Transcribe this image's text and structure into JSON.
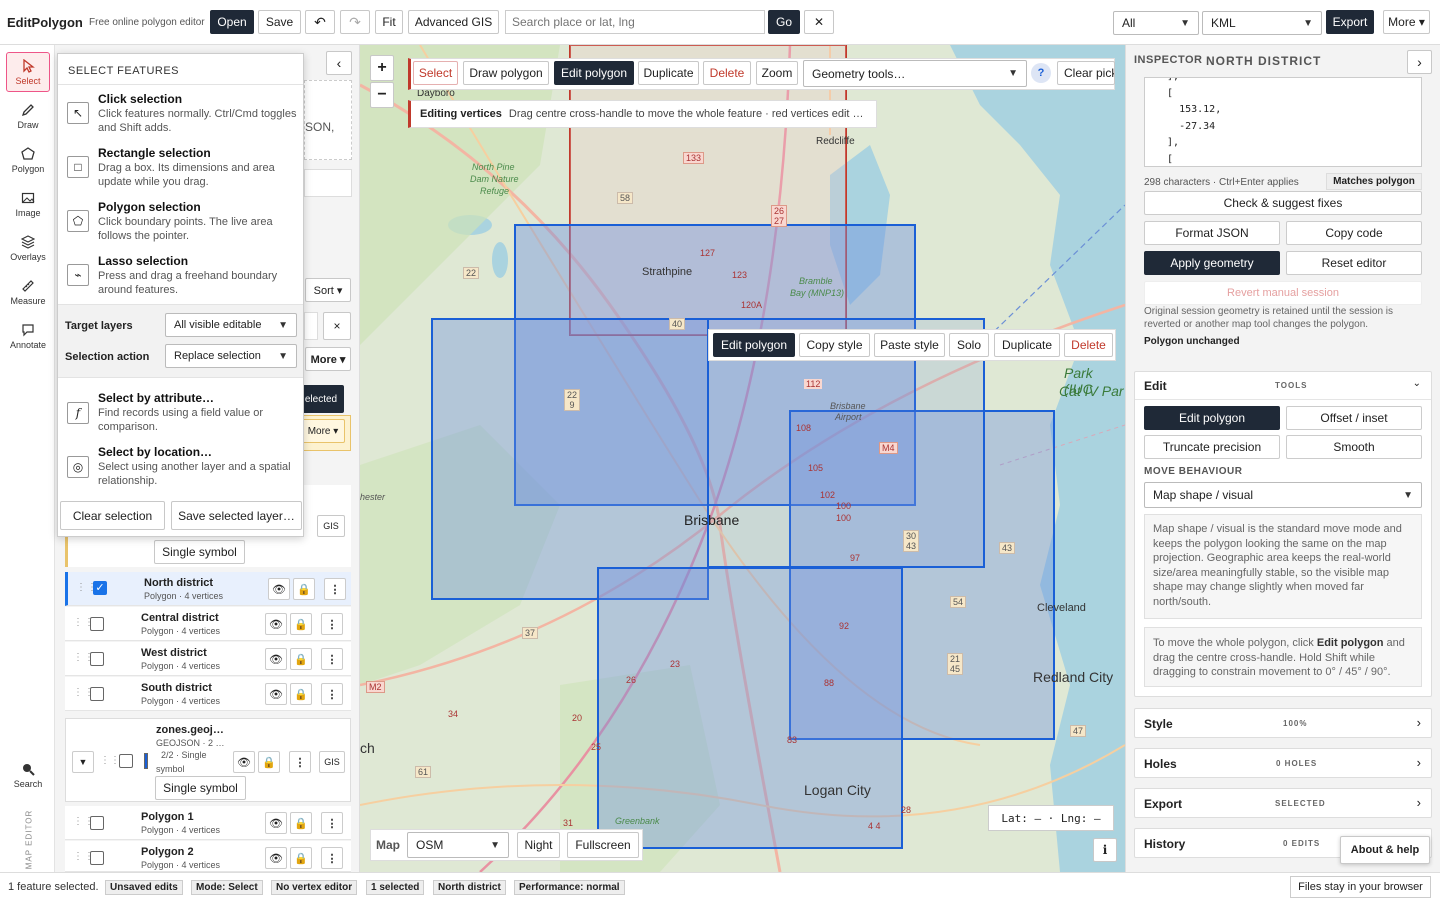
{
  "top": {
    "app": "EditPolygon",
    "tagline": "Free online polygon editor",
    "open": "Open",
    "save": "Save",
    "undo": "↶",
    "redo": "↷",
    "fit": "Fit",
    "advanced": "Advanced GIS",
    "search_placeholder": "Search place or lat, lng",
    "go": "Go",
    "clear": "✕",
    "scope": "All",
    "format": "KML",
    "export": "Export",
    "more": "More ▾"
  },
  "rail": [
    {
      "label": "Select",
      "icon": "cursor-icon"
    },
    {
      "label": "Draw",
      "icon": "pencil-icon"
    },
    {
      "label": "Polygon",
      "icon": "polygon-icon"
    },
    {
      "label": "Image",
      "icon": "image-icon"
    },
    {
      "label": "Overlays",
      "icon": "layers-icon"
    },
    {
      "label": "Measure",
      "icon": "ruler-icon"
    },
    {
      "label": "Annotate",
      "icon": "comment-icon"
    },
    {
      "label": "Search",
      "icon": "search-icon"
    }
  ],
  "rail_vertical": "MAP EDITOR",
  "select_dd": {
    "heading": "SELECT FEATURES",
    "items": [
      {
        "title": "Click selection",
        "desc": "Click features normally. Ctrl/Cmd toggles and Shift adds.",
        "icon": "↖"
      },
      {
        "title": "Rectangle selection",
        "desc": "Drag a box. Its dimensions and area update while you drag.",
        "icon": "□"
      },
      {
        "title": "Polygon selection",
        "desc": "Click boundary points. The live area follows the pointer.",
        "icon": "⬠"
      },
      {
        "title": "Lasso selection",
        "desc": "Press and drag a freehand boundary around features.",
        "icon": "⌁"
      }
    ],
    "target_label": "Target layers",
    "target_value": "All visible editable",
    "action_label": "Selection action",
    "action_value": "Replace selection",
    "attr_title": "Select by attribute…",
    "attr_desc": "Find records using a field value or comparison.",
    "loc_title": "Select by location…",
    "loc_desc": "Select using another layer and a spatial relationship.",
    "clear": "Clear selection",
    "save": "Save selected layer…"
  },
  "left": {
    "collapse": "‹",
    "frag_json": "SON,",
    "sort": "Sort ▾",
    "x": "×",
    "more": "More ▾",
    "selected": "elected",
    "more2": "More ▾",
    "gis": "GIS",
    "single_symbol": "Single symbol"
  },
  "layers": [
    {
      "name": "North district",
      "sub": "Polygon · 4 vertices",
      "checked": true
    },
    {
      "name": "Central district",
      "sub": "Polygon · 4 vertices",
      "checked": false
    },
    {
      "name": "West district",
      "sub": "Polygon · 4 vertices",
      "checked": false
    },
    {
      "name": "South district",
      "sub": "Polygon · 4 vertices",
      "checked": false
    }
  ],
  "group2": {
    "name": "zones.geoj…",
    "sub": "GEOJSON · 2 …",
    "sub2": "2/2 · Single",
    "sub3": "symbol",
    "gis": "GIS",
    "single": "Single symbol"
  },
  "layers2": [
    {
      "name": "Polygon 1",
      "sub": "Polygon · 4 vertices"
    },
    {
      "name": "Polygon 2",
      "sub": "Polygon · 4 vertices"
    }
  ],
  "map": {
    "zoom_in": "+",
    "zoom_out": "−",
    "tools": [
      "Select",
      "Draw polygon",
      "Edit polygon",
      "Duplicate",
      "Delete",
      "Zoom"
    ],
    "geom": "Geometry tools…",
    "help": "?",
    "clear_pick": "Clear pick",
    "banner_title": "Editing vertices",
    "banner_text": "Drag centre cross-handle to move the whole feature · red vertices edit …",
    "ctx": [
      "Edit polygon",
      "Copy style",
      "Paste style",
      "Solo",
      "Duplicate",
      "Delete"
    ],
    "basemap_label": "Map",
    "basemap": "OSM",
    "night": "Night",
    "fullscreen": "Fullscreen",
    "latlng": "Lat: – · Lng: –",
    "info": "i",
    "places": [
      {
        "t": "Dayboro"
      },
      {
        "t": "Redcliffe"
      },
      {
        "t": "North Pine"
      },
      {
        "t": "Dam Nature"
      },
      {
        "t": "Refuge"
      },
      {
        "t": "Strathpine"
      },
      {
        "t": "Bramble"
      },
      {
        "t": "Bay (MNP13)"
      },
      {
        "t": "Park (IUC"
      },
      {
        "t": "Cat IV Par"
      },
      {
        "t": "Brisbane"
      },
      {
        "t": "Airport"
      },
      {
        "t": "Brisbane"
      },
      {
        "t": "Cleveland"
      },
      {
        "t": "Redland City"
      },
      {
        "t": "Logan City"
      },
      {
        "t": "hester"
      },
      {
        "t": "ch"
      },
      {
        "t": "Greenbank"
      }
    ],
    "shields": [
      "133",
      "58",
      "26 27",
      "22",
      "40",
      "112",
      "108",
      "105",
      "102",
      "100",
      "100",
      "97",
      "30 43",
      "43",
      "54",
      "21 45",
      "47",
      "92",
      "88",
      "83",
      "37",
      "M2",
      "M4",
      "61",
      "34",
      "26",
      "23",
      "20",
      "4 4",
      "28",
      "31",
      "25",
      "22 9",
      "123",
      "120A",
      "127"
    ]
  },
  "inspector": {
    "label": "INSPECTOR",
    "title": "NORTH DISTRICT",
    "code": [
      "  ],",
      "  [",
      "    153.12,",
      "    -27.34",
      "  ],",
      "  ["
    ],
    "chars": "298 characters · Ctrl+Enter applies",
    "matches": "Matches polygon",
    "check": "Check & suggest fixes",
    "format": "Format JSON",
    "copy": "Copy code",
    "apply": "Apply geometry",
    "reset": "Reset editor",
    "revert": "Revert manual session",
    "note": "Original session geometry is retained until the session is reverted or another map tool changes the polygon.",
    "unchanged": "Polygon unchanged",
    "edit_title": "Edit",
    "tools_label": "TOOLS",
    "edit_poly": "Edit polygon",
    "offset": "Offset / inset",
    "truncate": "Truncate precision",
    "smooth": "Smooth",
    "move_label": "MOVE BEHAVIOUR",
    "move_value": "Map shape / visual",
    "move_help": "Map shape / visual is the standard move mode and keeps the polygon looking the same on the map projection. Geographic area keeps the real-world size/area meaningfully stable, so the visible map shape may change slightly when moved far north/south.",
    "move_tip_a": "To move the whole polygon, click ",
    "move_tip_b": "Edit polygon",
    "move_tip_c": " and drag the centre cross-handle. Hold Shift while dragging to constrain movement to 0° / 45° / 90°.",
    "sections": [
      {
        "t": "Style",
        "m": "100%"
      },
      {
        "t": "Holes",
        "m": "0 HOLES"
      },
      {
        "t": "Export",
        "m": "SELECTED"
      },
      {
        "t": "History",
        "m": "0 EDITS"
      }
    ],
    "about": "About & help",
    "expand": "›"
  },
  "status": {
    "text": "1 feature selected.",
    "tags": [
      "Unsaved edits",
      "Mode: Select",
      "No vertex editor",
      "1 selected",
      "North district",
      "Performance: normal"
    ],
    "files": "Files stay in your browser"
  },
  "colors": {
    "accent": "#1f2937",
    "select_red": "#c0392b",
    "poly_stroke": "#1a5fd6",
    "poly_fill": "#6d8ee0",
    "map_bg": "#dfe8d4",
    "water": "#aad3df"
  }
}
